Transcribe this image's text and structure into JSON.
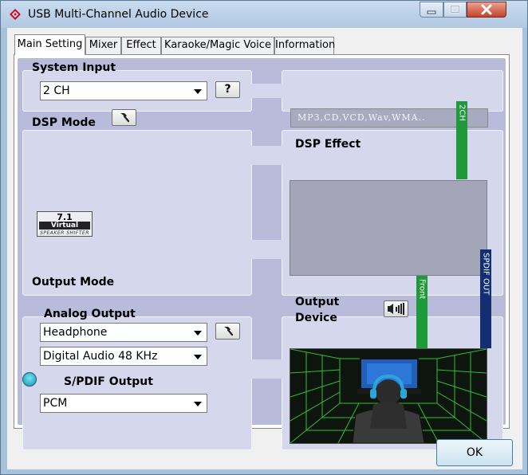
{
  "window": {
    "title": "USB Multi-Channel Audio Device",
    "colors": {
      "accent": "#3c7fb1",
      "panel": "#b8bcda",
      "section": "#d5d7ec",
      "green_bar": "#1f9a3a",
      "blue_bar": "#142e72"
    }
  },
  "tabs": [
    {
      "label": "Main Setting",
      "active": true
    },
    {
      "label": "Mixer",
      "active": false
    },
    {
      "label": "Effect",
      "active": false
    },
    {
      "label": "Karaoke/Magic Voice",
      "active": false
    },
    {
      "label": "Information",
      "active": false
    }
  ],
  "system_input": {
    "heading": "System Input",
    "selected": "2 CH",
    "help_label": "?",
    "formats": "MP3,CD,VCD,Wav,WMA.."
  },
  "dsp_mode": {
    "heading": "DSP Mode",
    "badge_line1": "7.1",
    "badge_line2": "Virtual",
    "badge_line3": "SPEAKER SHIFTER"
  },
  "dsp_effect": {
    "heading": "DSP Effect"
  },
  "output_mode": {
    "heading": "Output Mode",
    "analog_heading": "Analog Output",
    "analog_selected": "Headphone",
    "quality_selected": "Digital Audio 48 KHz",
    "spdif_heading": "S/PDIF Output",
    "spdif_selected": "PCM"
  },
  "output_device": {
    "heading_line1": "Output",
    "heading_line2": "Device"
  },
  "signal_bars": {
    "input": "2CH",
    "front": "Front",
    "spdif": "SPDIF OUT"
  },
  "buttons": {
    "ok": "OK"
  }
}
